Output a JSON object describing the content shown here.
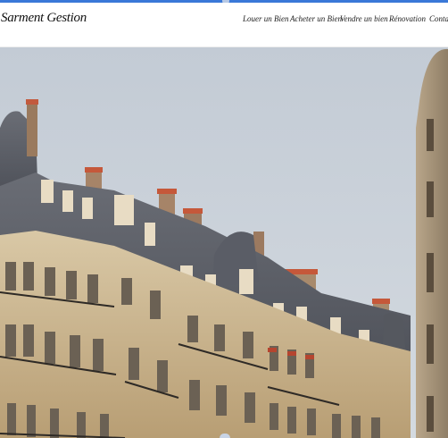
{
  "header": {
    "brand": "Sarment Gestion",
    "nav": [
      {
        "label": "Louer un Bien"
      },
      {
        "label": "Acheter un Bien"
      },
      {
        "label": "Vendre un bien"
      },
      {
        "label": "Rénovation"
      },
      {
        "label": "Contact"
      }
    ]
  },
  "hero": {
    "image_subject": "parisian-haussmann-buildings-photo"
  }
}
